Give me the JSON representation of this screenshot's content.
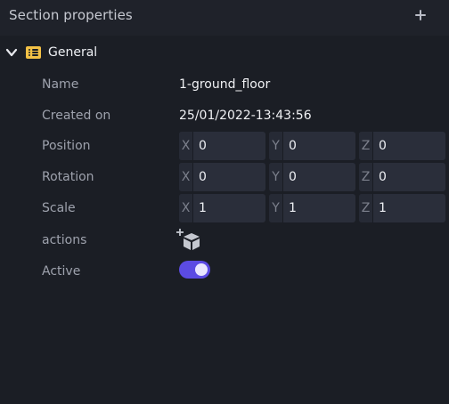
{
  "panel": {
    "title": "Section properties",
    "add_icon": "plus-icon"
  },
  "section": {
    "title": "General",
    "expand_icon": "chevron-down-icon",
    "icon": "list-icon",
    "icon_color": "#f3c146"
  },
  "fields": {
    "name": {
      "label": "Name",
      "value": "1-ground_floor"
    },
    "created_on": {
      "label": "Created on",
      "value": "25/01/2022-13:43:56"
    },
    "position": {
      "label": "Position",
      "x": "0",
      "y": "0",
      "z": "0"
    },
    "rotation": {
      "label": "Rotation",
      "x": "0",
      "y": "0",
      "z": "0"
    },
    "scale": {
      "label": "Scale",
      "x": "1",
      "y": "1",
      "z": "1"
    },
    "actions": {
      "label": "actions",
      "icon": "add-cube-icon"
    },
    "active": {
      "label": "Active",
      "value": true,
      "accent": "#5b4be3"
    }
  },
  "axes": {
    "x": "X",
    "y": "Y",
    "z": "Z"
  }
}
